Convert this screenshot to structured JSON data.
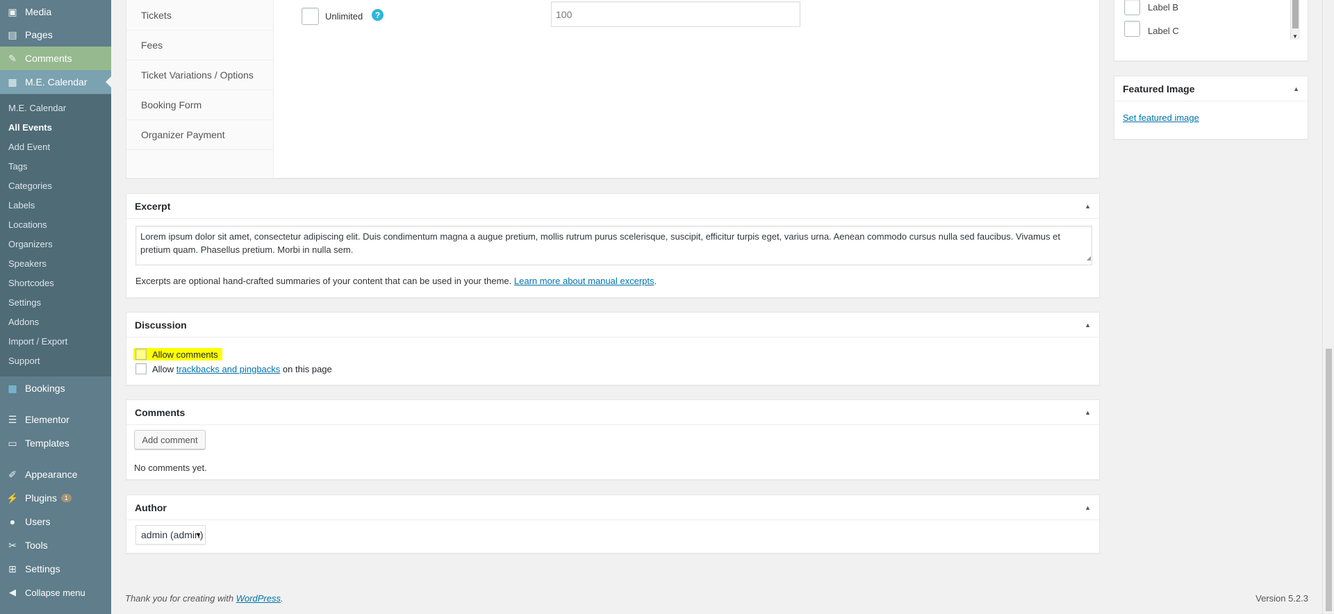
{
  "menu": {
    "top_items": [
      {
        "icon": "media-icon",
        "glyph": "▣",
        "label": "Media"
      },
      {
        "icon": "pages-icon",
        "glyph": "▤",
        "label": "Pages"
      },
      {
        "icon": "comments-icon",
        "glyph": "✎",
        "label": "Comments"
      },
      {
        "icon": "calendar-icon",
        "glyph": "▦",
        "label": "M.E. Calendar"
      }
    ],
    "submenu": [
      "M.E. Calendar",
      "All Events",
      "Add Event",
      "Tags",
      "Categories",
      "Labels",
      "Locations",
      "Organizers",
      "Speakers",
      "Shortcodes",
      "Settings",
      "Addons",
      "Import / Export",
      "Support"
    ],
    "bottom_items": [
      {
        "icon": "bookings-icon",
        "glyph": "▦",
        "label": "Bookings"
      },
      {
        "icon": "elementor-icon",
        "glyph": "☰",
        "label": "Elementor"
      },
      {
        "icon": "templates-icon",
        "glyph": "▭",
        "label": "Templates"
      },
      {
        "icon": "appearance-icon",
        "glyph": "✐",
        "label": "Appearance"
      },
      {
        "icon": "plugins-icon",
        "glyph": "⚡",
        "label": "Plugins",
        "badge": "1"
      },
      {
        "icon": "users-icon",
        "glyph": "●",
        "label": "Users"
      },
      {
        "icon": "tools-icon",
        "glyph": "✂",
        "label": "Tools"
      },
      {
        "icon": "settings-icon",
        "glyph": "⊞",
        "label": "Settings"
      },
      {
        "icon": "collapse-icon",
        "glyph": "◀",
        "label": "Collapse menu"
      }
    ]
  },
  "booking_box": {
    "tabs": [
      "Tickets",
      "Fees",
      "Ticket Variations / Options",
      "Booking Form",
      "Organizer Payment"
    ],
    "unlimited_label": "Unlimited",
    "help_glyph": "?",
    "limit_value": "100"
  },
  "labels_box": {
    "items": [
      "Label B",
      "Label C"
    ]
  },
  "featured_image": {
    "title": "Featured Image",
    "link": "Set featured image"
  },
  "excerpt": {
    "title": "Excerpt",
    "text": "Lorem ipsum dolor sit amet, consectetur adipiscing elit. Duis condimentum magna a augue pretium, mollis rutrum purus scelerisque, suscipit, efficitur turpis eget, varius urna. Aenean commodo cursus nulla sed faucibus. Vivamus et pretium quam. Phasellus pretium. Morbi in nulla sem.",
    "help_prefix": "Excerpts are optional hand-crafted summaries of your content that can be used in your theme.",
    "help_link": "Learn more about manual excerpts",
    "help_suffix": "."
  },
  "discussion": {
    "title": "Discussion",
    "allow_comments": "Allow comments",
    "allow_prefix": "Allow",
    "trackbacks_link": "trackbacks and pingbacks",
    "trackbacks_suffix": "on this page",
    "highlight_color": "#ffff00"
  },
  "comments": {
    "title": "Comments",
    "add_button": "Add comment",
    "empty": "No comments yet."
  },
  "author": {
    "title": "Author",
    "selected": "admin (admin)"
  },
  "footer": {
    "thanks_prefix": "Thank you for creating with",
    "thanks_link": "WordPress",
    "thanks_suffix": ".",
    "version": "Version 5.2.3"
  },
  "colors": {
    "sidebar": "#5f7d8a",
    "submenu": "#4f6b76",
    "active_green": "#96b98f",
    "link": "#0073aa",
    "help": "#2eb6d9"
  }
}
